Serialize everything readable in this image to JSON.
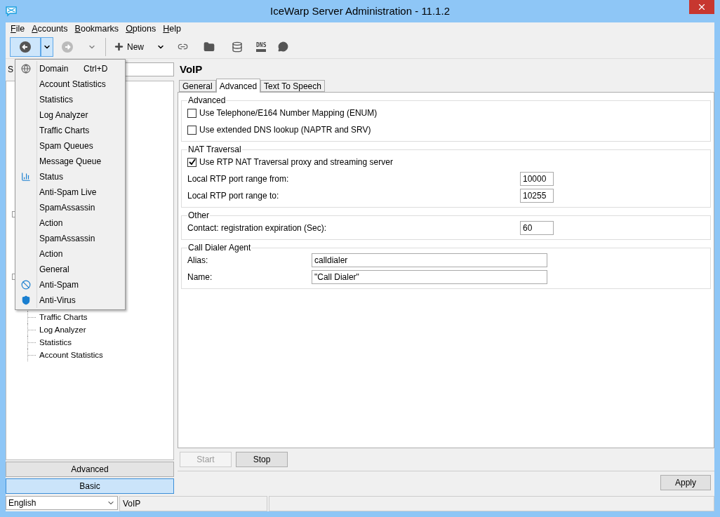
{
  "window": {
    "title": "IceWarp Server Administration - 11.1.2"
  },
  "menu_bar": [
    {
      "label": "File"
    },
    {
      "label": "Accounts"
    },
    {
      "label": "Bookmarks"
    },
    {
      "label": "Options"
    },
    {
      "label": "Help"
    }
  ],
  "toolbar": {
    "new_label": "New",
    "dns_label": "DNS",
    "back_pressed": true
  },
  "dropdown_menu": [
    {
      "label": "Domain",
      "kind": "globe",
      "shortcut": "Ctrl+D"
    },
    {
      "label": "Account Statistics",
      "kind": "plain"
    },
    {
      "label": "Statistics",
      "kind": "plain"
    },
    {
      "label": "Log Analyzer",
      "kind": "plain"
    },
    {
      "label": "Traffic Charts",
      "kind": "plain"
    },
    {
      "label": "Spam Queues",
      "kind": "plain"
    },
    {
      "label": "Message Queue",
      "kind": "plain"
    },
    {
      "label": "Status",
      "kind": "bars"
    },
    {
      "label": "Anti-Spam Live",
      "kind": "plain"
    },
    {
      "label": "SpamAssassin",
      "kind": "plain"
    },
    {
      "label": "Action",
      "kind": "plain"
    },
    {
      "label": "SpamAssassin",
      "kind": "plain"
    },
    {
      "label": "Action",
      "kind": "plain"
    },
    {
      "label": "General",
      "kind": "plain"
    },
    {
      "label": "Anti-Spam",
      "kind": "blocked"
    },
    {
      "label": "Anti-Virus",
      "kind": "shield"
    }
  ],
  "sidebar": {
    "search_label": "S",
    "tree": [
      {
        "label": "Traffic Charts"
      },
      {
        "label": "Log Analyzer"
      },
      {
        "label": "Statistics"
      },
      {
        "label": "Account Statistics"
      }
    ],
    "mode_buttons": [
      {
        "label": "Advanced",
        "selected": false
      },
      {
        "label": "Basic",
        "selected": true
      }
    ]
  },
  "page": {
    "title": "VoIP",
    "tabs": [
      {
        "label": "General",
        "selected": false
      },
      {
        "label": "Advanced",
        "selected": true
      },
      {
        "label": "Text To Speech",
        "selected": false
      }
    ],
    "groups": [
      {
        "title": "Advanced",
        "rows": [
          {
            "kind": "checkbox",
            "label": "Use Telephone/E164 Number Mapping (ENUM)",
            "checked": false
          },
          {
            "kind": "checkbox",
            "label": "Use extended DNS lookup (NAPTR and SRV)",
            "checked": false
          }
        ]
      },
      {
        "title": "NAT Traversal",
        "rows": [
          {
            "kind": "checkbox",
            "label": "Use RTP NAT Traversal proxy and streaming server",
            "checked": true
          },
          {
            "kind": "short_field",
            "label": "Local RTP port range from:",
            "value": "10000"
          },
          {
            "kind": "short_field",
            "label": "Local RTP port range to:",
            "value": "10255"
          }
        ]
      },
      {
        "title": "Other",
        "rows": [
          {
            "kind": "short_field",
            "label": "Contact: registration expiration (Sec):",
            "value": "60"
          }
        ]
      },
      {
        "title": "Call Dialer Agent",
        "rows": [
          {
            "kind": "wide_field",
            "label": "Alias:",
            "value": "calldialer"
          },
          {
            "kind": "wide_field",
            "label": "Name:",
            "value": "\"Call Dialer\""
          }
        ]
      }
    ],
    "buttons": [
      {
        "label": "Start",
        "disabled": true
      },
      {
        "label": "Stop",
        "disabled": false
      }
    ],
    "apply": "Apply"
  },
  "status_bar": {
    "language": "English",
    "section": "VoIP"
  }
}
